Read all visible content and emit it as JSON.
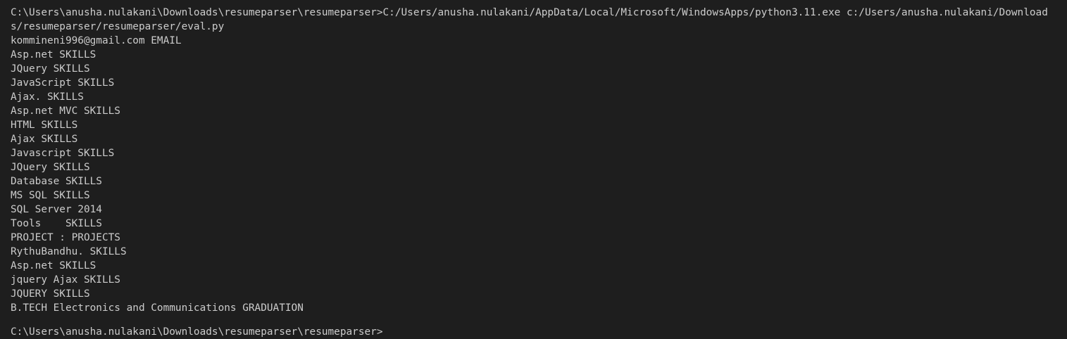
{
  "terminal": {
    "command": "C:\\Users\\anusha.nulakani\\Downloads\\resumeparser\\resumeparser>C:/Users/anusha.nulakani/AppData/Local/Microsoft/WindowsApps/python3.11.exe c:/Users/anusha.nulakani/Downloads/resumeparser/resumeparser/eval.py",
    "output": [
      "kommineni996@gmail.com EMAIL",
      "Asp.net SKILLS",
      "JQuery SKILLS",
      "JavaScript SKILLS",
      "Ajax. SKILLS",
      "Asp.net MVC SKILLS",
      "HTML SKILLS",
      "Ajax SKILLS",
      "Javascript SKILLS",
      "JQuery SKILLS",
      "Database SKILLS",
      "MS SQL SKILLS",
      "SQL Server 2014",
      "Tools    SKILLS",
      "PROJECT : PROJECTS",
      "RythuBandhu. SKILLS",
      "Asp.net SKILLS",
      "jquery Ajax SKILLS",
      "JQUERY SKILLS",
      "B.TECH Electronics and Communications GRADUATION"
    ],
    "cut_off_line": "C:\\Users\\anusha.nulakani\\Downloads\\resumeparser\\resumeparser>"
  }
}
